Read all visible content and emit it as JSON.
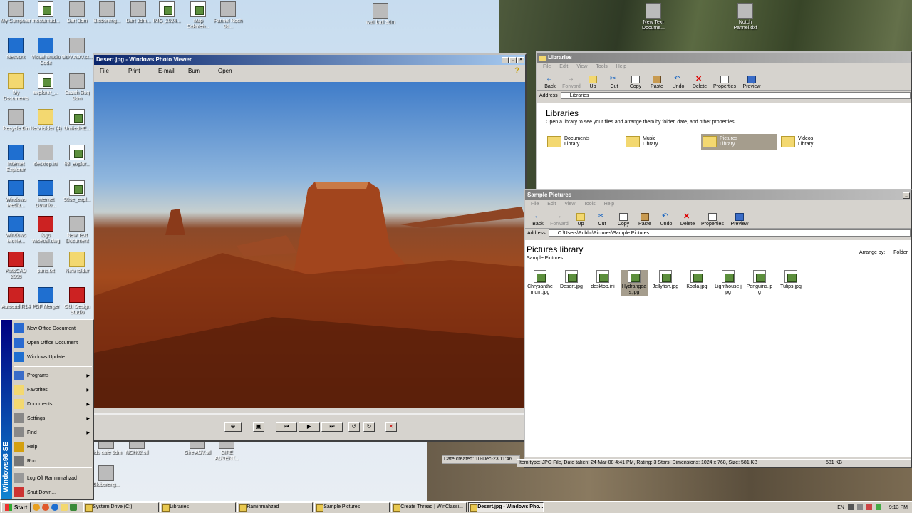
{
  "desktop": {
    "icons": [
      {
        "label": "My Computer",
        "kind": "gray"
      },
      {
        "label": "mostamad...",
        "kind": "doc"
      },
      {
        "label": "Dart 3dm",
        "kind": "gray"
      },
      {
        "label": "Bloboreng...",
        "kind": "gray"
      },
      {
        "label": "Dart 3dm...",
        "kind": "gray"
      },
      {
        "label": "IMG_2024...",
        "kind": "doc"
      },
      {
        "label": "Map Sakhteh...",
        "kind": "doc"
      },
      {
        "label": "Pannel Noch 3d...",
        "kind": "gray"
      },
      {
        "label": "wall ball 3dm",
        "kind": "gray"
      },
      {
        "label": "New Text Docume...",
        "kind": "gray"
      },
      {
        "label": "Notch Pannel.dxf",
        "kind": "gray"
      },
      {
        "label": "Network",
        "kind": "blue"
      },
      {
        "label": "Visual Studio Code",
        "kind": "blue"
      },
      {
        "label": "GDV.ADV.st...",
        "kind": "gray"
      },
      {
        "label": "My Documents",
        "kind": "folder"
      },
      {
        "label": "explorer_...",
        "kind": "doc"
      },
      {
        "label": "Sazeh Boq 3dm",
        "kind": "gray"
      },
      {
        "label": "Recycle Bin",
        "kind": "gray"
      },
      {
        "label": "New folder (4)",
        "kind": "folder"
      },
      {
        "label": "UnifiedHE...",
        "kind": "doc"
      },
      {
        "label": "Internet Explorer",
        "kind": "blue"
      },
      {
        "label": "desktop.ini",
        "kind": "gray"
      },
      {
        "label": "98_explor...",
        "kind": "doc"
      },
      {
        "label": "Windows Media...",
        "kind": "blue"
      },
      {
        "label": "Internet Downlo...",
        "kind": "blue"
      },
      {
        "label": "98se_expl...",
        "kind": "doc"
      },
      {
        "label": "Windows Movie...",
        "kind": "blue"
      },
      {
        "label": "logo vaseoal.dwg",
        "kind": "red"
      },
      {
        "label": "New Text Document",
        "kind": "gray"
      },
      {
        "label": "AutoCAD 2008",
        "kind": "red"
      },
      {
        "label": "pans.txt",
        "kind": "gray"
      },
      {
        "label": "New folder",
        "kind": "folder"
      },
      {
        "label": "Autocad R14",
        "kind": "red"
      },
      {
        "label": "PDF Merger",
        "kind": "blue"
      },
      {
        "label": "GUI Design Studio",
        "kind": "red"
      },
      {
        "label": "kids cafe 3dm",
        "kind": "gray"
      },
      {
        "label": "NCH02.stl",
        "kind": "gray"
      },
      {
        "label": "Gire ADV.stl",
        "kind": "gray"
      },
      {
        "label": "GIRE ADVENT...",
        "kind": "gray"
      },
      {
        "label": "Bloboreng...",
        "kind": "gray"
      }
    ]
  },
  "photo_viewer": {
    "title": "Desert.jpg - Windows Photo Viewer",
    "menu": [
      "File",
      "Print",
      "E-mail",
      "Burn",
      "Open"
    ],
    "controls": [
      "⊕",
      "▣",
      "⏮",
      "▶",
      "⏭",
      "↺",
      "↻",
      "✕"
    ]
  },
  "libraries_window": {
    "title": "Libraries",
    "menu": [
      "File",
      "Edit",
      "View",
      "Tools",
      "Help"
    ],
    "toolbar": [
      "Back",
      "Forward",
      "Up",
      "Cut",
      "Copy",
      "Paste",
      "Undo",
      "Delete",
      "Properties",
      "Preview"
    ],
    "address_label": "Address",
    "address": "Libraries",
    "heading": "Libraries",
    "subheading": "Open a library to see your files and arrange them by folder, date, and other properties.",
    "libraries": [
      {
        "name": "Documents",
        "type": "Library"
      },
      {
        "name": "Music",
        "type": "Library"
      },
      {
        "name": "Pictures",
        "type": "Library"
      },
      {
        "name": "Videos",
        "type": "Library"
      }
    ]
  },
  "pictures_window": {
    "title": "Sample Pictures",
    "menu": [
      "File",
      "Edit",
      "View",
      "Tools",
      "Help"
    ],
    "toolbar": [
      "Back",
      "Forward",
      "Up",
      "Cut",
      "Copy",
      "Paste",
      "Undo",
      "Delete",
      "Properties",
      "Preview"
    ],
    "address_label": "Address",
    "address": "C:\\Users\\Public\\Pictures\\Sample Pictures",
    "heading": "Pictures library",
    "subheading": "Sample Pictures",
    "arrange_label": "Arrange by:",
    "arrange_value": "Folder",
    "files": [
      "Chrysanthemum.jpg",
      "Desert.jpg",
      "desktop.ini",
      "Hydrangeas.jpg",
      "Jellyfish.jpg",
      "Koala.jpg",
      "Lighthouse.jpg",
      "Penguins.jpg",
      "Tulips.jpg"
    ],
    "status_left": "Item type: JPG File, Date taken: 24-Mar-08 4:41 PM, Rating: 3 Stars, Dimensions: 1024 x 768, Size: 581 KB",
    "status_right": "581 KB",
    "date_created": "Date created: 10-Dec-23 11:46"
  },
  "start_menu": {
    "banner": "Windows98 SE",
    "items": [
      {
        "label": "New Office Document",
        "submenu": false
      },
      {
        "label": "Open Office Document",
        "submenu": false
      },
      {
        "label": "Windows Update",
        "submenu": false
      },
      {
        "label": "Programs",
        "submenu": true
      },
      {
        "label": "Favorites",
        "submenu": true
      },
      {
        "label": "Documents",
        "submenu": true
      },
      {
        "label": "Settings",
        "submenu": true
      },
      {
        "label": "Find",
        "submenu": true
      },
      {
        "label": "Help",
        "submenu": false
      },
      {
        "label": "Run...",
        "submenu": false
      },
      {
        "label": "Log Off Raminmahzad",
        "submenu": false
      },
      {
        "label": "Shut Down...",
        "submenu": false
      }
    ]
  },
  "taskbar": {
    "start_label": "Start",
    "tasks": [
      {
        "label": "System Drive (C:)",
        "active": false
      },
      {
        "label": "Libraries",
        "active": false
      },
      {
        "label": "Raminmahzad",
        "active": false
      },
      {
        "label": "Sample Pictures",
        "active": false
      },
      {
        "label": "Create Thread | WinClassi...",
        "active": false
      },
      {
        "label": "Desert.jpg - Windows Pho...",
        "active": true
      }
    ],
    "language": "EN",
    "time": "9:13 PM"
  },
  "colors": {
    "titlebar_active": "#0a246a",
    "titlebar_inactive": "#7f7f7f",
    "window_face": "#d6d3ce",
    "selection": "#a59d8d",
    "start_banner": "#000080"
  }
}
